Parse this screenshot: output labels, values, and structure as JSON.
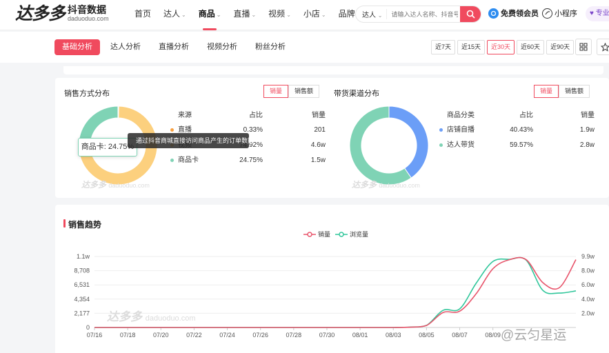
{
  "header": {
    "logo_main": "达多多",
    "logo_sub": "抖音数据",
    "logo_domain": "daduoduo.com",
    "nav": [
      {
        "label": "首页",
        "chevron": false
      },
      {
        "label": "达人",
        "chevron": true
      },
      {
        "label": "商品",
        "chevron": true
      },
      {
        "label": "直播",
        "chevron": true
      },
      {
        "label": "视频",
        "chevron": true
      },
      {
        "label": "小店",
        "chevron": true
      },
      {
        "label": "品牌",
        "chevron": true
      }
    ],
    "active_nav": "商品",
    "search_type": "达人",
    "search_placeholder": "请输入达人名称、抖音号",
    "vip_label": "免费领会员",
    "mini_label": "小程序",
    "pro_label": "专业版"
  },
  "subnav": {
    "tabs": [
      "基础分析",
      "达人分析",
      "直播分析",
      "视频分析",
      "粉丝分析"
    ],
    "active_tab": "基础分析",
    "ranges": [
      "近7天",
      "近15天",
      "近30天",
      "近60天",
      "近90天"
    ],
    "active_range": "近30天"
  },
  "sales_method": {
    "title": "销售方式分布",
    "toggle": [
      "销量",
      "销售额"
    ],
    "active_toggle": "销量",
    "headers": [
      "来源",
      "占比",
      "销量"
    ],
    "rows": [
      {
        "name": "直播",
        "pct": "0.33%",
        "value": "201",
        "color": "#f9a03f"
      },
      {
        "name": "视频",
        "pct": "74.92%",
        "value": "4.6w",
        "color": "#fcd07e"
      },
      {
        "name": "商品卡",
        "pct": "24.75%",
        "value": "1.5w",
        "color": "#7fd3b5"
      }
    ],
    "tooltip": "商品卡: 24.75%",
    "hint": "通过抖音商城直接访问商品产生的订单数据"
  },
  "channel": {
    "title": "带货渠道分布",
    "toggle": [
      "销量",
      "销售额"
    ],
    "active_toggle": "销量",
    "headers": [
      "商品分类",
      "占比",
      "销量"
    ],
    "rows": [
      {
        "name": "店铺自播",
        "pct": "40.43%",
        "value": "1.9w",
        "color": "#6b9ef7"
      },
      {
        "name": "达人带货",
        "pct": "59.57%",
        "value": "2.8w",
        "color": "#7fd3b5"
      }
    ]
  },
  "watermark": {
    "main": "达多多",
    "domain": "daduoduo.com"
  },
  "trend": {
    "title": "销售趋势",
    "legend": [
      "销量",
      "浏览量"
    ]
  },
  "corner_watermark": "@云匀星运",
  "chart_data": {
    "type": "line",
    "title": "销售趋势",
    "x": [
      "07/16",
      "07/17",
      "07/18",
      "07/19",
      "07/20",
      "07/21",
      "07/22",
      "07/23",
      "07/24",
      "07/25",
      "07/26",
      "07/27",
      "07/28",
      "07/29",
      "07/30",
      "07/31",
      "08/01",
      "08/02",
      "08/03",
      "08/04",
      "08/05",
      "08/06",
      "08/07",
      "08/08",
      "08/09",
      "08/10",
      "08/11",
      "08/12",
      "08/13",
      "08/14"
    ],
    "x_tick_labels": [
      "07/16",
      "07/18",
      "07/20",
      "07/22",
      "07/24",
      "07/26",
      "07/28",
      "07/30",
      "08/01",
      "08/03",
      "08/05",
      "08/07",
      "08/09"
    ],
    "y_left_ticks": [
      "0",
      "2,177",
      "4,354",
      "6,531",
      "8,708",
      "1.1w"
    ],
    "y_right_ticks": [
      "",
      "2.0w",
      "4.0w",
      "6.0w",
      "8.0w",
      "9.9w"
    ],
    "ylim_left": [
      0,
      10885
    ],
    "ylim_right": [
      0,
      99000
    ],
    "series": [
      {
        "name": "销量",
        "axis": "left",
        "color": "#e8536a",
        "values": [
          0,
          0,
          0,
          0,
          0,
          0,
          0,
          0,
          0,
          0,
          0,
          0,
          0,
          0,
          0,
          0,
          0,
          0,
          0,
          50,
          300,
          2300,
          2500,
          5200,
          9000,
          10400,
          10400,
          6900,
          6100,
          10400
        ]
      },
      {
        "name": "浏览量",
        "axis": "right",
        "color": "#2fc69a",
        "values": [
          0,
          0,
          0,
          0,
          0,
          0,
          0,
          0,
          0,
          0,
          0,
          0,
          0,
          0,
          0,
          0,
          0,
          0,
          0,
          600,
          3000,
          24000,
          26000,
          62000,
          92000,
          95000,
          94000,
          52000,
          48000,
          51000
        ]
      }
    ],
    "legend_position": "top-center",
    "grid": true
  }
}
